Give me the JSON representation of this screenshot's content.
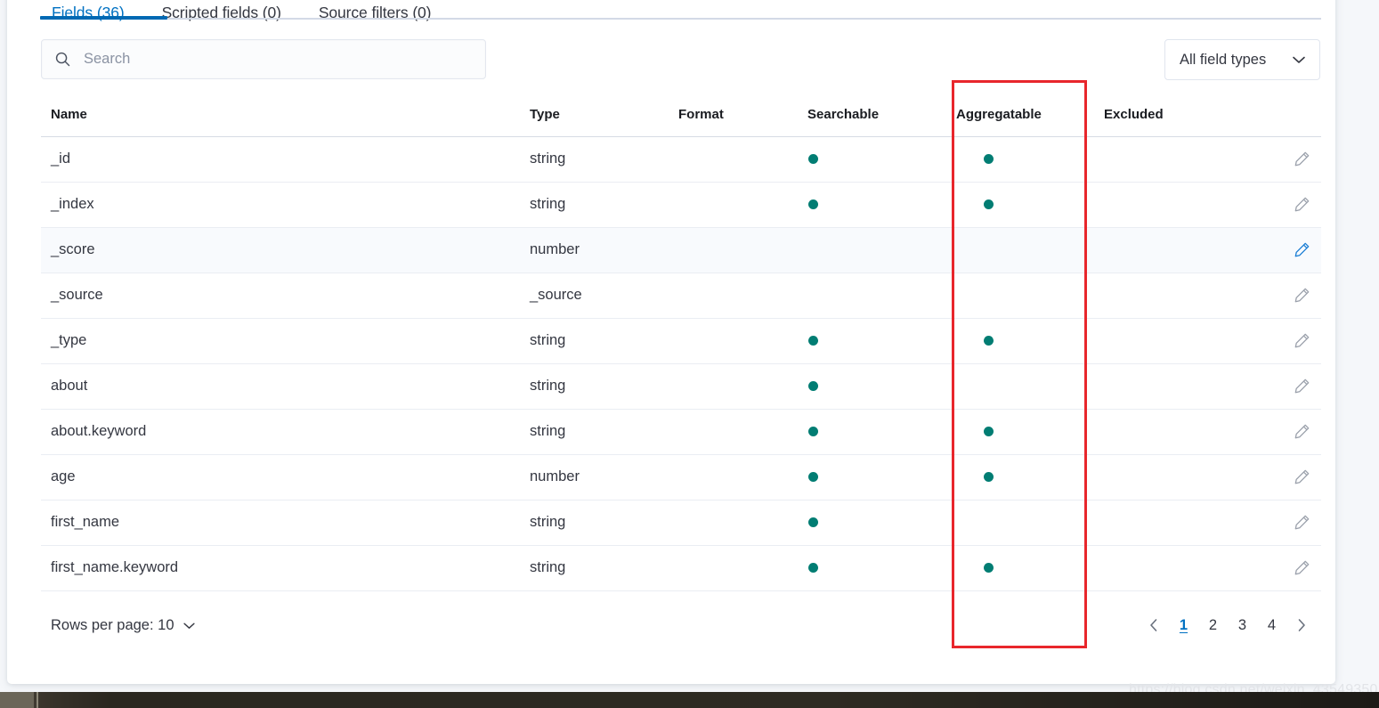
{
  "tabs": [
    {
      "label": "Fields (36)",
      "active": true
    },
    {
      "label": "Scripted fields (0)",
      "active": false
    },
    {
      "label": "Source filters (0)",
      "active": false
    }
  ],
  "search": {
    "placeholder": "Search",
    "value": "",
    "icon": "search-icon"
  },
  "filter": {
    "label": "All field types",
    "icon": "chevron-down-icon"
  },
  "table": {
    "columns": [
      "Name",
      "Type",
      "Format",
      "Searchable",
      "Aggregatable",
      "Excluded"
    ],
    "rows": [
      {
        "name": "_id",
        "type": "string",
        "format": "",
        "searchable": true,
        "aggregatable": true,
        "excluded": "",
        "highlighted": false,
        "edit_active": false
      },
      {
        "name": "_index",
        "type": "string",
        "format": "",
        "searchable": true,
        "aggregatable": true,
        "excluded": "",
        "highlighted": false,
        "edit_active": false
      },
      {
        "name": "_score",
        "type": "number",
        "format": "",
        "searchable": false,
        "aggregatable": false,
        "excluded": "",
        "highlighted": true,
        "edit_active": true
      },
      {
        "name": "_source",
        "type": "_source",
        "format": "",
        "searchable": false,
        "aggregatable": false,
        "excluded": "",
        "highlighted": false,
        "edit_active": false
      },
      {
        "name": "_type",
        "type": "string",
        "format": "",
        "searchable": true,
        "aggregatable": true,
        "excluded": "",
        "highlighted": false,
        "edit_active": false
      },
      {
        "name": "about",
        "type": "string",
        "format": "",
        "searchable": true,
        "aggregatable": false,
        "excluded": "",
        "highlighted": false,
        "edit_active": false
      },
      {
        "name": "about.keyword",
        "type": "string",
        "format": "",
        "searchable": true,
        "aggregatable": true,
        "excluded": "",
        "highlighted": false,
        "edit_active": false
      },
      {
        "name": "age",
        "type": "number",
        "format": "",
        "searchable": true,
        "aggregatable": true,
        "excluded": "",
        "highlighted": false,
        "edit_active": false
      },
      {
        "name": "first_name",
        "type": "string",
        "format": "",
        "searchable": true,
        "aggregatable": false,
        "excluded": "",
        "highlighted": false,
        "edit_active": false
      },
      {
        "name": "first_name.keyword",
        "type": "string",
        "format": "",
        "searchable": true,
        "aggregatable": true,
        "excluded": "",
        "highlighted": false,
        "edit_active": false
      }
    ],
    "row_edit_icon": "pencil-icon"
  },
  "footer": {
    "rows_per_page_label": "Rows per page: 10",
    "rows_per_page_icon": "chevron-down-icon",
    "prev_icon": "chevron-left-icon",
    "next_icon": "chevron-right-icon",
    "pages": [
      "1",
      "2",
      "3",
      "4"
    ],
    "active_page": "1"
  },
  "annotation": {
    "target_column": "Aggregatable",
    "color": "#e8262c"
  },
  "watermark": {
    "text": "https://blog.csdn.net/weixin_43549350"
  },
  "colors": {
    "accent_blue": "#0071c2",
    "tab_underline": "#0069b3",
    "dot_teal": "#017d73",
    "pencil_active": "#1a7dd4",
    "annotation_red": "#e8262c"
  }
}
